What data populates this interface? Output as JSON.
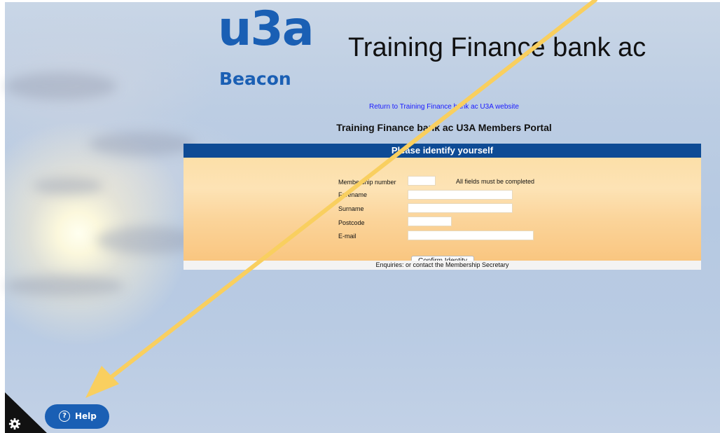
{
  "branding": {
    "logo_mark": "u3a",
    "logo_sub": "Beacon",
    "site_title": "Training Finance bank ac"
  },
  "return_link": "Return to Training Finance bank ac U3A website",
  "portal_heading": "Training Finance bank ac U3A Members Portal",
  "form": {
    "header": "Please identify yourself",
    "note": "All fields must be completed",
    "fields": {
      "membership_number": "Membership number",
      "forename": "Forename",
      "surname": "Surname",
      "postcode": "Postcode",
      "email": "E-mail"
    },
    "confirm_label": "Confirm Identity",
    "footer": "Enquiries: or contact the Membership Secretary"
  },
  "help": {
    "label": "Help",
    "icon_glyph": "?"
  },
  "icons": {
    "settings": "gear-icon",
    "help": "question-circle-icon",
    "annotation": "arrow-annotation"
  },
  "colors": {
    "brand_blue": "#1a5fb4",
    "header_blue": "#0e4b95",
    "arrow_yellow": "#f9cf5f"
  }
}
